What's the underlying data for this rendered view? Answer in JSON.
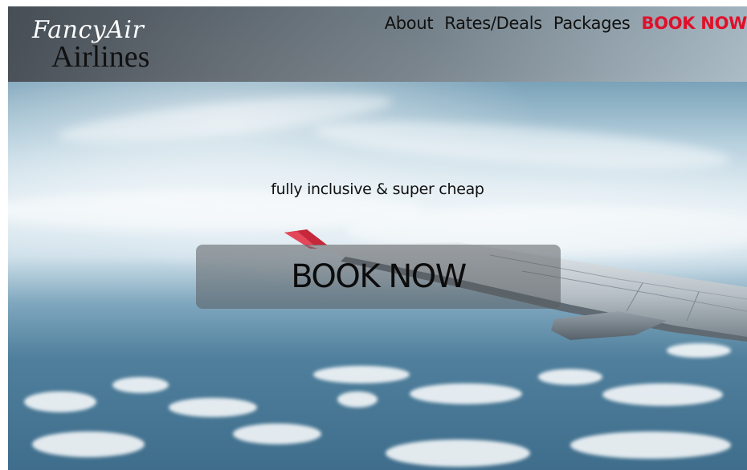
{
  "brand": {
    "script_name": "FancyAir",
    "main_name": "Airlines"
  },
  "nav": {
    "items": [
      {
        "label": "About"
      },
      {
        "label": "Rates/Deals"
      },
      {
        "label": "Packages"
      },
      {
        "label": "BOOK NOW"
      }
    ]
  },
  "hero": {
    "tagline": "fully inclusive & super cheap",
    "cta_label": "BOOK NOW"
  },
  "colors": {
    "accent": "#e0102a",
    "header_dark": "#464a50",
    "text": "#111111"
  },
  "icons": {
    "background": "airplane-wing-sky-image"
  }
}
